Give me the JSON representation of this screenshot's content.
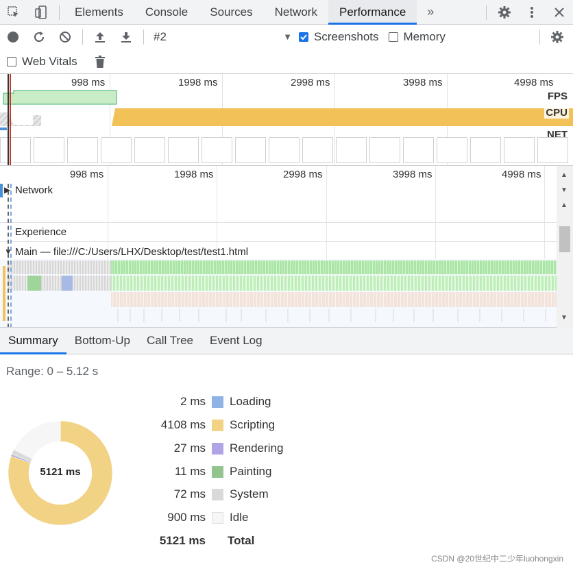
{
  "tabs": {
    "items": [
      {
        "label": "Elements"
      },
      {
        "label": "Console"
      },
      {
        "label": "Sources"
      },
      {
        "label": "Network"
      },
      {
        "label": "Performance"
      }
    ],
    "more_icon": "chevron-double-right-icon"
  },
  "toolbar": {
    "recording_select": "#2",
    "screenshots_label": "Screenshots",
    "screenshots_checked": true,
    "memory_label": "Memory",
    "memory_checked": false,
    "web_vitals_label": "Web Vitals",
    "web_vitals_checked": false
  },
  "overview": {
    "ticks": [
      "998 ms",
      "1998 ms",
      "2998 ms",
      "3998 ms",
      "4998 ms"
    ],
    "fps_label": "FPS",
    "cpu_label": "CPU",
    "net_label": "NET"
  },
  "timeline": {
    "ticks": [
      "998 ms",
      "1998 ms",
      "2998 ms",
      "3998 ms",
      "4998 ms"
    ],
    "tracks": {
      "network": "Network",
      "experience": "Experience",
      "main": "Main — file:///C:/Users/LHX/Desktop/test/test1.html"
    }
  },
  "bottom_tabs": [
    {
      "label": "Summary"
    },
    {
      "label": "Bottom-Up"
    },
    {
      "label": "Call Tree"
    },
    {
      "label": "Event Log"
    }
  ],
  "summary": {
    "range": "Range: 0 – 5.12 s",
    "total_center": "5121 ms",
    "rows": [
      {
        "value": "2 ms",
        "name": "Loading",
        "color": "#8fb3e4",
        "ms": 2
      },
      {
        "value": "4108 ms",
        "name": "Scripting",
        "color": "#f2d284",
        "ms": 4108
      },
      {
        "value": "27 ms",
        "name": "Rendering",
        "color": "#b0a3e6",
        "ms": 27
      },
      {
        "value": "11 ms",
        "name": "Painting",
        "color": "#93c48e",
        "ms": 11
      },
      {
        "value": "72 ms",
        "name": "System",
        "color": "#d9d9d9",
        "ms": 72
      },
      {
        "value": "900 ms",
        "name": "Idle",
        "color": "#f6f6f6",
        "ms": 900
      }
    ],
    "total": {
      "value": "5121 ms",
      "name": "Total"
    }
  },
  "watermark": "CSDN @20世纪中二少年luohongxin"
}
